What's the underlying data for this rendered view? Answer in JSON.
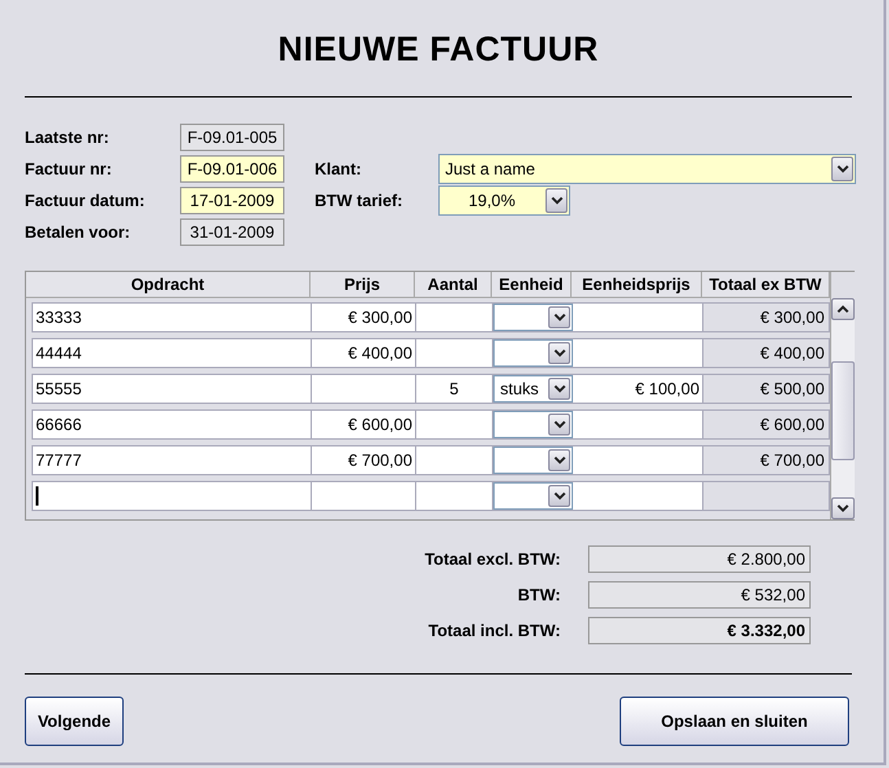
{
  "title": "NIEUWE FACTUUR",
  "fields": [
    {
      "label": "Laatste nr:",
      "value": "F-09.01-005",
      "disabled": true
    },
    {
      "label": "Factuur nr:",
      "value": "F-09.01-006",
      "disabled": false
    },
    {
      "label": "Factuur datum:",
      "value": "17-01-2009",
      "disabled": false
    },
    {
      "label": "Betalen voor:",
      "value": "31-01-2009",
      "disabled": true
    }
  ],
  "client": {
    "label": "Klant:",
    "value": "Just a name"
  },
  "vat_rate": {
    "label": "BTW tarief:",
    "value": "19,0%"
  },
  "table": {
    "columns": [
      "Opdracht",
      "Prijs",
      "Aantal",
      "Eenheid",
      "Eenheidsprijs",
      "Totaal ex BTW"
    ],
    "rows": [
      {
        "opdracht": "33333",
        "prijs": "€ 300,00",
        "totaal": "€ 300,00",
        "focused": false
      },
      {
        "opdracht": "44444",
        "prijs": "€ 400,00",
        "totaal": "€ 400,00",
        "focused": false
      },
      {
        "opdracht": "55555",
        "aantal": "5",
        "eenheid": "stuks",
        "eenheidsprijs": "€ 100,00",
        "totaal": "€ 500,00",
        "focused": false
      },
      {
        "opdracht": "66666",
        "prijs": "€ 600,00",
        "totaal": "€ 600,00",
        "focused": false
      },
      {
        "opdracht": "77777",
        "prijs": "€ 700,00",
        "totaal": "€ 700,00",
        "focused": false
      },
      {
        "focused": true
      }
    ]
  },
  "totals": [
    {
      "label": "Totaal excl. BTW:",
      "value": "€ 2.800,00",
      "bold": false
    },
    {
      "label": "BTW:",
      "value": "€ 532,00",
      "bold": false
    },
    {
      "label": "Totaal incl. BTW:",
      "value": "€ 3.332,00",
      "bold": true
    }
  ],
  "buttons": [
    {
      "label": "Volgende",
      "kind": "small"
    },
    {
      "label": "Opslaan en sluiten",
      "kind": "wide"
    }
  ]
}
